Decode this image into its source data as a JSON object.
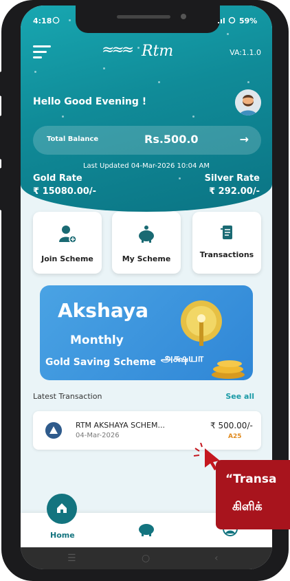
{
  "status_bar": {
    "time": "4:18",
    "battery": "59%"
  },
  "header": {
    "logo_text": "Rtm",
    "version": "VA:1.1.0"
  },
  "greeting": "Hello Good Evening !",
  "balance": {
    "label": "Total Balance",
    "amount": "Rs.500.0",
    "arrow": "→"
  },
  "last_updated": "Last Updated 04-Mar-2026 10:04 AM",
  "gold_rate": {
    "label": "Gold Rate",
    "value": "₹ 15080.00/-"
  },
  "silver_rate": {
    "label": "Silver Rate",
    "value": "₹ 292.00/-"
  },
  "tiles": [
    {
      "label": "Join Scheme",
      "icon": "add-user-icon"
    },
    {
      "label": "My Scheme",
      "icon": "piggy-bank-icon"
    },
    {
      "label": "Transactions",
      "icon": "receipt-icon"
    }
  ],
  "banner": {
    "title": "Akshaya",
    "subtitle": "Monthly",
    "scheme": "Gold Saving Scheme",
    "tamil": "அக்ஷயா"
  },
  "latest": {
    "title": "Latest Transaction",
    "see_all": "See all"
  },
  "transaction": {
    "name": "RTM AKSHAYA SCHEM...",
    "date": "04-Mar-2026",
    "amount": "₹ 500.00/-",
    "code": "A25"
  },
  "bottom_nav": {
    "home_label": "Home"
  },
  "callout": {
    "line1": "“Transa",
    "line2": "கிளிக்"
  },
  "colors": {
    "primary": "#13747f",
    "accent": "#e08a1e",
    "callout": "#a8141d"
  }
}
